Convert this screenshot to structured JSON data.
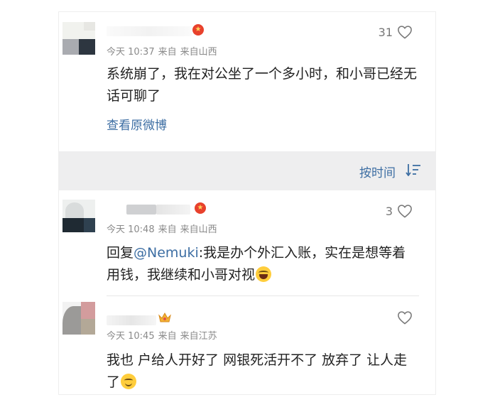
{
  "comments": [
    {
      "likes": "31",
      "time": "今天 10:37",
      "from": "来自",
      "location": "来自山西",
      "text": "系统崩了，我在对公坐了一个多小时，和小哥已经无话可聊了",
      "link": "查看原微博"
    },
    {
      "likes": "3",
      "time": "今天 10:48",
      "from": "来自",
      "location": "来自山西",
      "reply_prefix": "回复",
      "mention": "@Nemuki",
      "text": ":我是办个外汇入账，实在是想等着用钱，我继续和小哥对视"
    },
    {
      "likes": "",
      "time": "今天 10:45",
      "from": "来自",
      "location": "来自江苏",
      "text": "我也 户给人开好了 网银死活开不了 放弃了 让人走了"
    }
  ],
  "sort": {
    "label": "按时间"
  },
  "icons": {
    "like": "heart-outline-icon",
    "sort": "sort-lines-icon",
    "badge": "weibo-badge-icon",
    "crown": "crown-icon",
    "laugh": "laugh-cry-emoji",
    "smile": "smile-emoji"
  },
  "colors": {
    "link": "#3d6ea3",
    "text": "#222222",
    "meta": "#8a8a8a",
    "sort_bar": "#eeeeef"
  }
}
